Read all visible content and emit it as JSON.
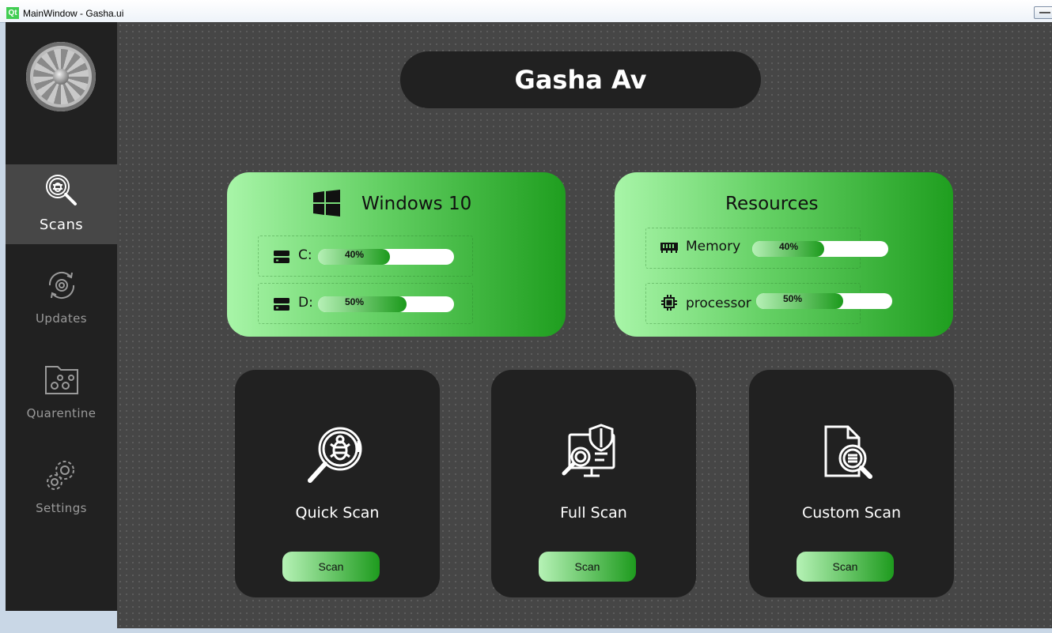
{
  "window": {
    "title": "MainWindow - Gasha.ui",
    "icon_text": "Qt"
  },
  "sidebar": {
    "items": [
      {
        "label": "Scans",
        "icon": "scan-bug-magnifier-icon",
        "active": true
      },
      {
        "label": "Updates",
        "icon": "gear-refresh-icon",
        "active": false
      },
      {
        "label": "Quarentine",
        "icon": "quarantine-folder-icon",
        "active": false
      },
      {
        "label": "Settings",
        "icon": "gears-icon",
        "active": false
      }
    ]
  },
  "header": {
    "title": "Gasha Av"
  },
  "system": {
    "os_name": "Windows 10",
    "drives": [
      {
        "label": "C:",
        "percent": 40,
        "percent_text": "40%"
      },
      {
        "label": "D:",
        "percent": 50,
        "percent_text": "50%"
      }
    ]
  },
  "resources": {
    "title": "Resources",
    "items": [
      {
        "label": "Memory",
        "icon": "ram-icon",
        "percent": 40,
        "percent_text": "40%"
      },
      {
        "label": "processor",
        "icon": "cpu-icon",
        "percent": 50,
        "percent_text": "50%"
      }
    ]
  },
  "scans": [
    {
      "title": "Quick Scan",
      "button": "Scan",
      "icon": "bug-magnifier-icon"
    },
    {
      "title": "Full Scan",
      "button": "Scan",
      "icon": "shield-computer-scan-icon"
    },
    {
      "title": "Custom Scan",
      "button": "Scan",
      "icon": "document-search-icon"
    }
  ],
  "colors": {
    "sidebar_bg": "#212121",
    "sidebar_active": "#474747",
    "main_bg": "#464646",
    "accent_light": "#a8f5a8",
    "accent_dark": "#1f9e1f"
  }
}
